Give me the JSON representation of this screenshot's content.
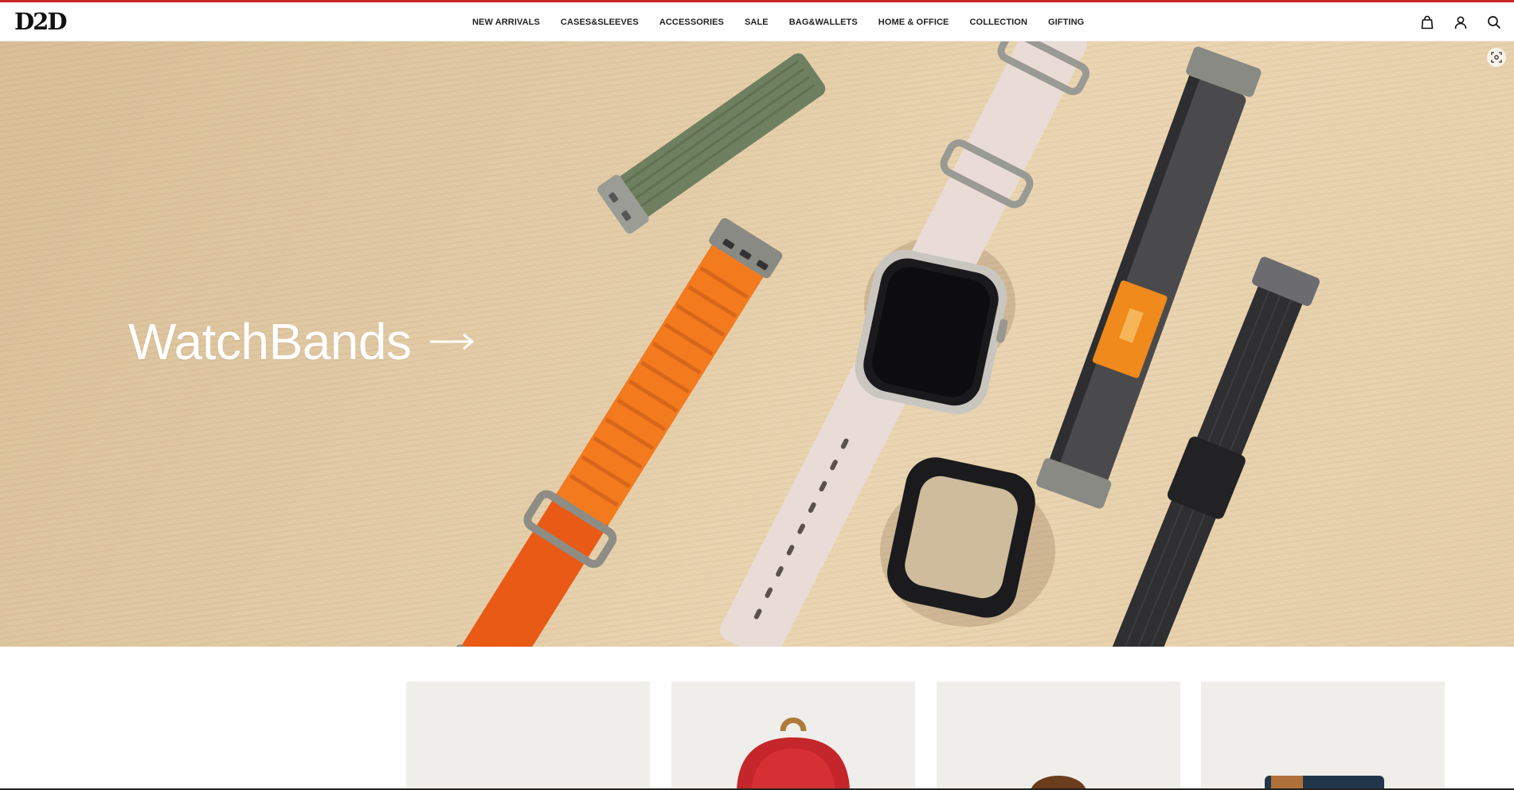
{
  "brand": {
    "logo_text": "D2D",
    "accent_color": "#c62828"
  },
  "nav": {
    "items": [
      {
        "label": "NEW ARRIVALS"
      },
      {
        "label": "CASES&SLEEVES"
      },
      {
        "label": "ACCESSORIES"
      },
      {
        "label": "SALE"
      },
      {
        "label": "BAG&WALLETS"
      },
      {
        "label": "HOME & OFFICE"
      },
      {
        "label": "COLLECTION"
      },
      {
        "label": "GIFTING"
      }
    ]
  },
  "header_icons": [
    "bag-icon",
    "account-icon",
    "search-icon"
  ],
  "hero": {
    "title": "WatchBands",
    "arrow_icon": "arrow-right-icon",
    "scan_icon": "image-scan-icon"
  },
  "product_cards": [
    {
      "image": "blank-product"
    },
    {
      "image": "red-backpack"
    },
    {
      "image": "leather-item"
    },
    {
      "image": "navy-wallet"
    }
  ]
}
